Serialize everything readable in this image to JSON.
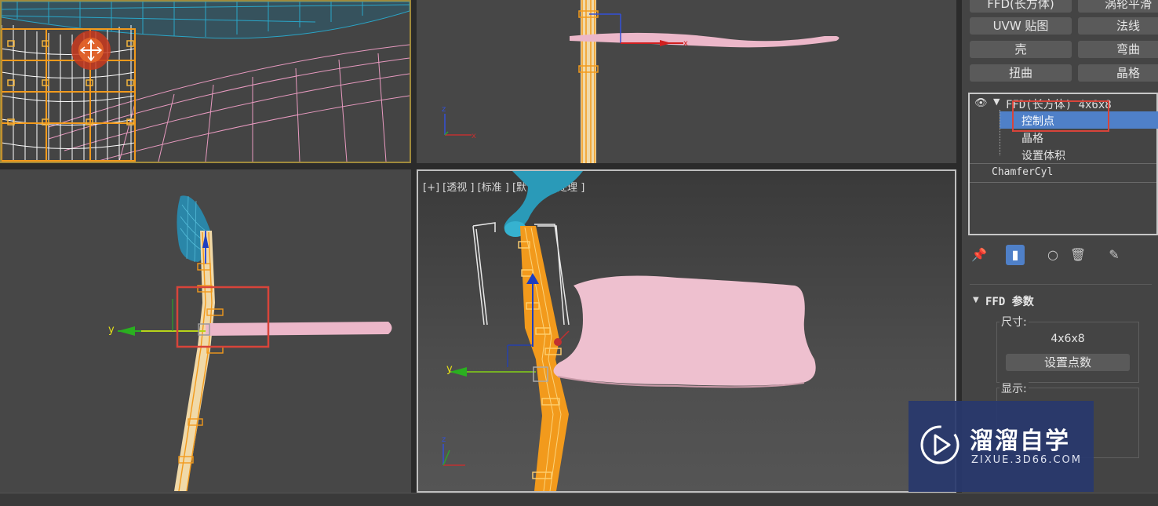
{
  "viewport_br": {
    "label": "[+] [透视 ] [标准 ] [默认明暗处理 ]"
  },
  "axes": {
    "x": "x",
    "y": "y",
    "z": "z"
  },
  "modifier_buttons": [
    {
      "id": "ffd-box",
      "label": "FFD(长方体)"
    },
    {
      "id": "turbosmooth",
      "label": "涡轮平滑"
    },
    {
      "id": "uvw-map",
      "label": "UVW 贴图"
    },
    {
      "id": "normal",
      "label": "法线"
    },
    {
      "id": "shell",
      "label": "壳"
    },
    {
      "id": "bend",
      "label": "弯曲"
    },
    {
      "id": "twist",
      "label": "扭曲"
    },
    {
      "id": "lattice",
      "label": "晶格"
    }
  ],
  "modifier_stack": {
    "ffd_item": "FFD(长方体) 4x6x8",
    "control_points": "控制点",
    "lattice": "晶格",
    "set_volume": "设置体积",
    "base_object": "ChamferCyl"
  },
  "ffd_params": {
    "title": "FFD 参数",
    "dimensions_label": "尺寸:",
    "dimensions_value": "4x6x8",
    "set_points_button": "设置点数",
    "display_label": "显示:"
  },
  "watermark": {
    "title": "溜溜自学",
    "subtitle": "ZIXUE.3D66.COM"
  },
  "colors": {
    "highlight_red": "#d8443a",
    "selection_blue": "#4f80c8",
    "pink_seat": "#e9b7c7",
    "teal_object": "#2a9ab8",
    "orange_lattice": "#f29a1c"
  }
}
